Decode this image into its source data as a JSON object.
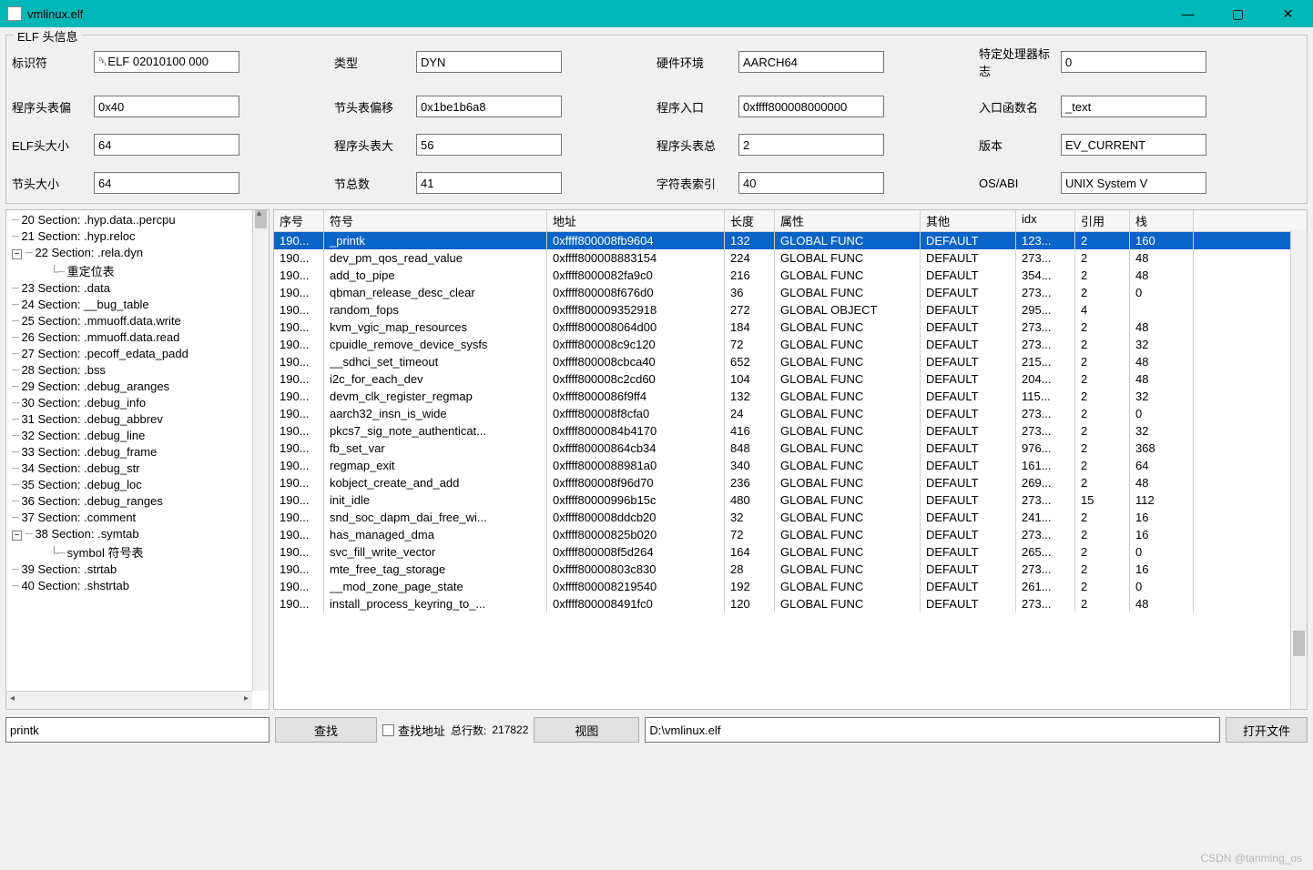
{
  "window": {
    "title": "vmlinux.elf"
  },
  "groupbox_title": "ELF 头信息",
  "fields": {
    "ident_label": "标识符",
    "ident_val": "␡ELF 02010100 000",
    "type_label": "类型",
    "type_val": "DYN",
    "machine_label": "硬件环境",
    "machine_val": "AARCH64",
    "flags_label": "特定处理器标志",
    "flags_val": "0",
    "phoff_label": "程序头表偏",
    "phoff_val": "0x40",
    "shoff_label": "节头表偏移",
    "shoff_val": "0x1be1b6a8",
    "entry_label": "程序入口",
    "entry_val": "0xffff800008000000",
    "entryfn_label": "入口函数名",
    "entryfn_val": "_text",
    "ehsize_label": "ELF头大小",
    "ehsize_val": "64",
    "phsize_label": "程序头表大",
    "phsize_val": "56",
    "phnum_label": "程序头表总",
    "phnum_val": "2",
    "version_label": "版本",
    "version_val": "EV_CURRENT",
    "shsize_label": "节头大小",
    "shsize_val": "64",
    "shnum_label": "节总数",
    "shnum_val": "41",
    "shstr_label": "字符表索引",
    "shstr_val": "40",
    "osabi_label": "OS/ABI",
    "osabi_val": "UNIX System V"
  },
  "tree": [
    {
      "txt": "20 Section: .hyp.data..percpu"
    },
    {
      "txt": "21 Section: .hyp.reloc"
    },
    {
      "txt": "22 Section: .rela.dyn",
      "exp": true
    },
    {
      "txt": "重定位表",
      "child": true
    },
    {
      "txt": "23 Section: .data"
    },
    {
      "txt": "24 Section: __bug_table"
    },
    {
      "txt": "25 Section: .mmuoff.data.write"
    },
    {
      "txt": "26 Section: .mmuoff.data.read"
    },
    {
      "txt": "27 Section: .pecoff_edata_padd"
    },
    {
      "txt": "28 Section: .bss"
    },
    {
      "txt": "29 Section: .debug_aranges"
    },
    {
      "txt": "30 Section: .debug_info"
    },
    {
      "txt": "31 Section: .debug_abbrev"
    },
    {
      "txt": "32 Section: .debug_line"
    },
    {
      "txt": "33 Section: .debug_frame"
    },
    {
      "txt": "34 Section: .debug_str"
    },
    {
      "txt": "35 Section: .debug_loc"
    },
    {
      "txt": "36 Section: .debug_ranges"
    },
    {
      "txt": "37 Section: .comment"
    },
    {
      "txt": "38 Section: .symtab",
      "exp": true
    },
    {
      "txt": "symbol 符号表",
      "child": true,
      "sel": true
    },
    {
      "txt": "39 Section: .strtab"
    },
    {
      "txt": "40 Section: .shstrtab"
    }
  ],
  "table": {
    "headers": {
      "seq": "序号",
      "sym": "符号",
      "addr": "地址",
      "len": "长度",
      "attr": "属性",
      "other": "其他",
      "idx": "idx",
      "ref": "引用",
      "stack": "栈"
    },
    "rows": [
      {
        "seq": "190...",
        "sym": "_printk",
        "addr": "0xffff800008fb9604",
        "len": "132",
        "attr": "GLOBAL FUNC",
        "other": "DEFAULT",
        "idx": "123...",
        "ref": "2",
        "stack": "160",
        "sel": true
      },
      {
        "seq": "190...",
        "sym": "dev_pm_qos_read_value",
        "addr": "0xffff800008883154",
        "len": "224",
        "attr": "GLOBAL FUNC",
        "other": "DEFAULT",
        "idx": "273...",
        "ref": "2",
        "stack": "48"
      },
      {
        "seq": "190...",
        "sym": "add_to_pipe",
        "addr": "0xffff8000082fa9c0",
        "len": "216",
        "attr": "GLOBAL FUNC",
        "other": "DEFAULT",
        "idx": "354...",
        "ref": "2",
        "stack": "48"
      },
      {
        "seq": "190...",
        "sym": "qbman_release_desc_clear",
        "addr": "0xffff800008f676d0",
        "len": "36",
        "attr": "GLOBAL FUNC",
        "other": "DEFAULT",
        "idx": "273...",
        "ref": "2",
        "stack": "0"
      },
      {
        "seq": "190...",
        "sym": "random_fops",
        "addr": "0xffff800009352918",
        "len": "272",
        "attr": "GLOBAL OBJECT",
        "other": "DEFAULT",
        "idx": "295...",
        "ref": "4",
        "stack": ""
      },
      {
        "seq": "190...",
        "sym": "kvm_vgic_map_resources",
        "addr": "0xffff800008064d00",
        "len": "184",
        "attr": "GLOBAL FUNC",
        "other": "DEFAULT",
        "idx": "273...",
        "ref": "2",
        "stack": "48"
      },
      {
        "seq": "190...",
        "sym": "cpuidle_remove_device_sysfs",
        "addr": "0xffff800008c9c120",
        "len": "72",
        "attr": "GLOBAL FUNC",
        "other": "DEFAULT",
        "idx": "273...",
        "ref": "2",
        "stack": "32"
      },
      {
        "seq": "190...",
        "sym": "__sdhci_set_timeout",
        "addr": "0xffff800008cbca40",
        "len": "652",
        "attr": "GLOBAL FUNC",
        "other": "DEFAULT",
        "idx": "215...",
        "ref": "2",
        "stack": "48"
      },
      {
        "seq": "190...",
        "sym": "i2c_for_each_dev",
        "addr": "0xffff800008c2cd60",
        "len": "104",
        "attr": "GLOBAL FUNC",
        "other": "DEFAULT",
        "idx": "204...",
        "ref": "2",
        "stack": "48"
      },
      {
        "seq": "190...",
        "sym": "devm_clk_register_regmap",
        "addr": "0xffff8000086f9ff4",
        "len": "132",
        "attr": "GLOBAL FUNC",
        "other": "DEFAULT",
        "idx": "115...",
        "ref": "2",
        "stack": "32"
      },
      {
        "seq": "190...",
        "sym": "aarch32_insn_is_wide",
        "addr": "0xffff800008f8cfa0",
        "len": "24",
        "attr": "GLOBAL FUNC",
        "other": "DEFAULT",
        "idx": "273...",
        "ref": "2",
        "stack": "0"
      },
      {
        "seq": "190...",
        "sym": "pkcs7_sig_note_authenticat...",
        "addr": "0xffff8000084b4170",
        "len": "416",
        "attr": "GLOBAL FUNC",
        "other": "DEFAULT",
        "idx": "273...",
        "ref": "2",
        "stack": "32"
      },
      {
        "seq": "190...",
        "sym": "fb_set_var",
        "addr": "0xffff80000864cb34",
        "len": "848",
        "attr": "GLOBAL FUNC",
        "other": "DEFAULT",
        "idx": "976...",
        "ref": "2",
        "stack": "368"
      },
      {
        "seq": "190...",
        "sym": "regmap_exit",
        "addr": "0xffff8000088981a0",
        "len": "340",
        "attr": "GLOBAL FUNC",
        "other": "DEFAULT",
        "idx": "161...",
        "ref": "2",
        "stack": "64"
      },
      {
        "seq": "190...",
        "sym": "kobject_create_and_add",
        "addr": "0xffff800008f96d70",
        "len": "236",
        "attr": "GLOBAL FUNC",
        "other": "DEFAULT",
        "idx": "269...",
        "ref": "2",
        "stack": "48"
      },
      {
        "seq": "190...",
        "sym": "init_idle",
        "addr": "0xffff80000996b15c",
        "len": "480",
        "attr": "GLOBAL FUNC",
        "other": "DEFAULT",
        "idx": "273...",
        "ref": "15",
        "stack": "112"
      },
      {
        "seq": "190...",
        "sym": "snd_soc_dapm_dai_free_wi...",
        "addr": "0xffff800008ddcb20",
        "len": "32",
        "attr": "GLOBAL FUNC",
        "other": "DEFAULT",
        "idx": "241...",
        "ref": "2",
        "stack": "16"
      },
      {
        "seq": "190...",
        "sym": "has_managed_dma",
        "addr": "0xffff80000825b020",
        "len": "72",
        "attr": "GLOBAL FUNC",
        "other": "DEFAULT",
        "idx": "273...",
        "ref": "2",
        "stack": "16"
      },
      {
        "seq": "190...",
        "sym": "svc_fill_write_vector",
        "addr": "0xffff800008f5d264",
        "len": "164",
        "attr": "GLOBAL FUNC",
        "other": "DEFAULT",
        "idx": "265...",
        "ref": "2",
        "stack": "0"
      },
      {
        "seq": "190...",
        "sym": "mte_free_tag_storage",
        "addr": "0xffff80000803c830",
        "len": "28",
        "attr": "GLOBAL FUNC",
        "other": "DEFAULT",
        "idx": "273...",
        "ref": "2",
        "stack": "16"
      },
      {
        "seq": "190...",
        "sym": "__mod_zone_page_state",
        "addr": "0xffff800008219540",
        "len": "192",
        "attr": "GLOBAL FUNC",
        "other": "DEFAULT",
        "idx": "261...",
        "ref": "2",
        "stack": "0"
      },
      {
        "seq": "190...",
        "sym": "install_process_keyring_to_...",
        "addr": "0xffff800008491fc0",
        "len": "120",
        "attr": "GLOBAL FUNC",
        "other": "DEFAULT",
        "idx": "273...",
        "ref": "2",
        "stack": "48"
      }
    ]
  },
  "bottom": {
    "search_val": "printk",
    "find_btn": "查找",
    "find_addr_chk": "查找地址",
    "rowcount_label": "总行数:",
    "rowcount_val": "217822",
    "view_btn": "视图",
    "path_val": "D:\\vmlinux.elf",
    "open_btn": "打开文件"
  },
  "watermark": "CSDN @tanming_os"
}
